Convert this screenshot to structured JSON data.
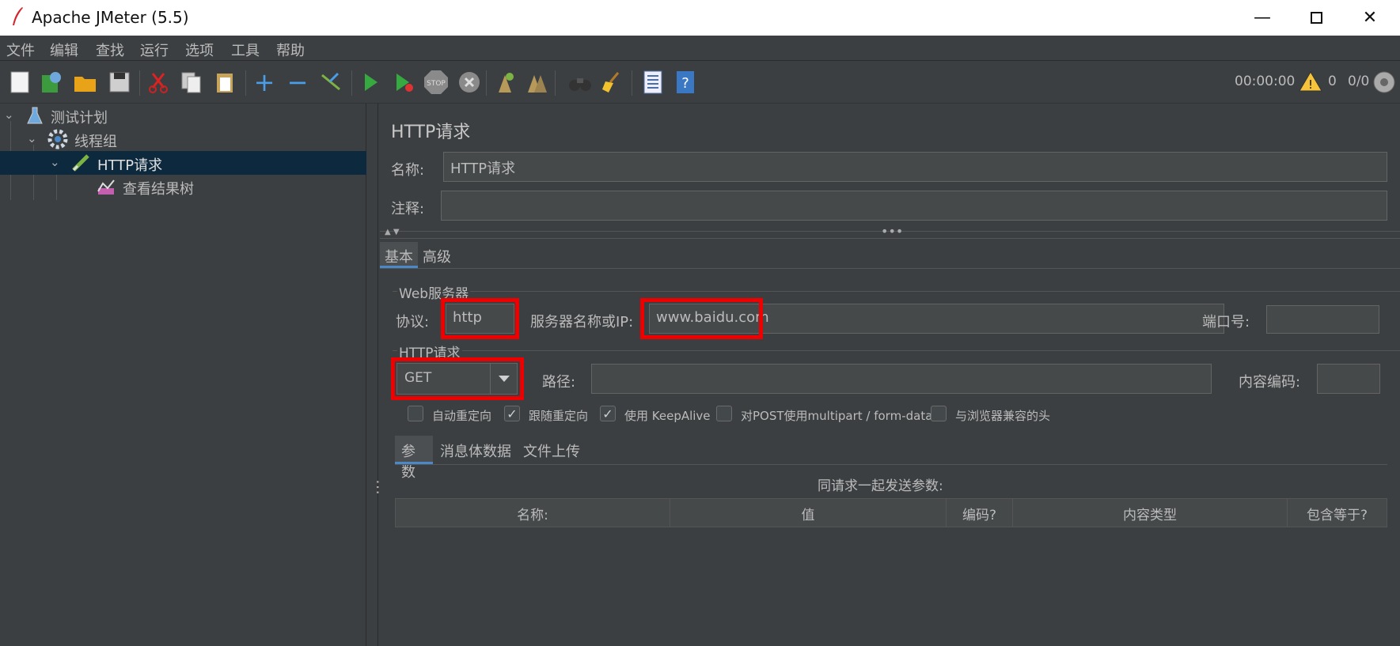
{
  "window": {
    "title": "Apache JMeter (5.5)"
  },
  "menu": [
    "文件",
    "编辑",
    "查找",
    "运行",
    "选项",
    "工具",
    "帮助"
  ],
  "toolbar_status": {
    "time": "00:00:00",
    "warnings": "0",
    "threads": "0/0"
  },
  "tree": {
    "items": [
      {
        "label": "测试计划",
        "icon": "test-plan-icon"
      },
      {
        "label": "线程组",
        "icon": "thread-group-icon"
      },
      {
        "label": "HTTP请求",
        "icon": "http-sampler-icon",
        "selected": true
      },
      {
        "label": "查看结果树",
        "icon": "result-tree-icon"
      }
    ]
  },
  "panel": {
    "title": "HTTP请求",
    "name_label": "名称:",
    "name_value": "HTTP请求",
    "comment_label": "注释:",
    "comment_value": "",
    "tabs": [
      "基本",
      "高级"
    ],
    "web_server": {
      "legend": "Web服务器",
      "protocol_label": "协议:",
      "protocol_value": "http",
      "server_label": "服务器名称或IP:",
      "server_value": "www.baidu.com",
      "port_label": "端口号:",
      "port_value": ""
    },
    "http_request": {
      "legend": "HTTP请求",
      "method": "GET",
      "path_label": "路径:",
      "path_value": "",
      "encoding_label": "内容编码:",
      "encoding_value": ""
    },
    "checkboxes": [
      {
        "label": "自动重定向",
        "checked": false
      },
      {
        "label": "跟随重定向",
        "checked": true
      },
      {
        "label": "使用 KeepAlive",
        "checked": true
      },
      {
        "label": "对POST使用multipart / form-data",
        "checked": false
      },
      {
        "label": "与浏览器兼容的头",
        "checked": false
      }
    ],
    "sub_tabs": [
      "参数",
      "消息体数据",
      "文件上传"
    ],
    "params_caption": "同请求一起发送参数:",
    "table_headers": [
      "名称:",
      "值",
      "编码?",
      "内容类型",
      "包含等于?"
    ]
  },
  "colors": {
    "highlight": "#ee0000",
    "selected_row": "#0d293e",
    "tab_accent": "#4a88c7"
  }
}
